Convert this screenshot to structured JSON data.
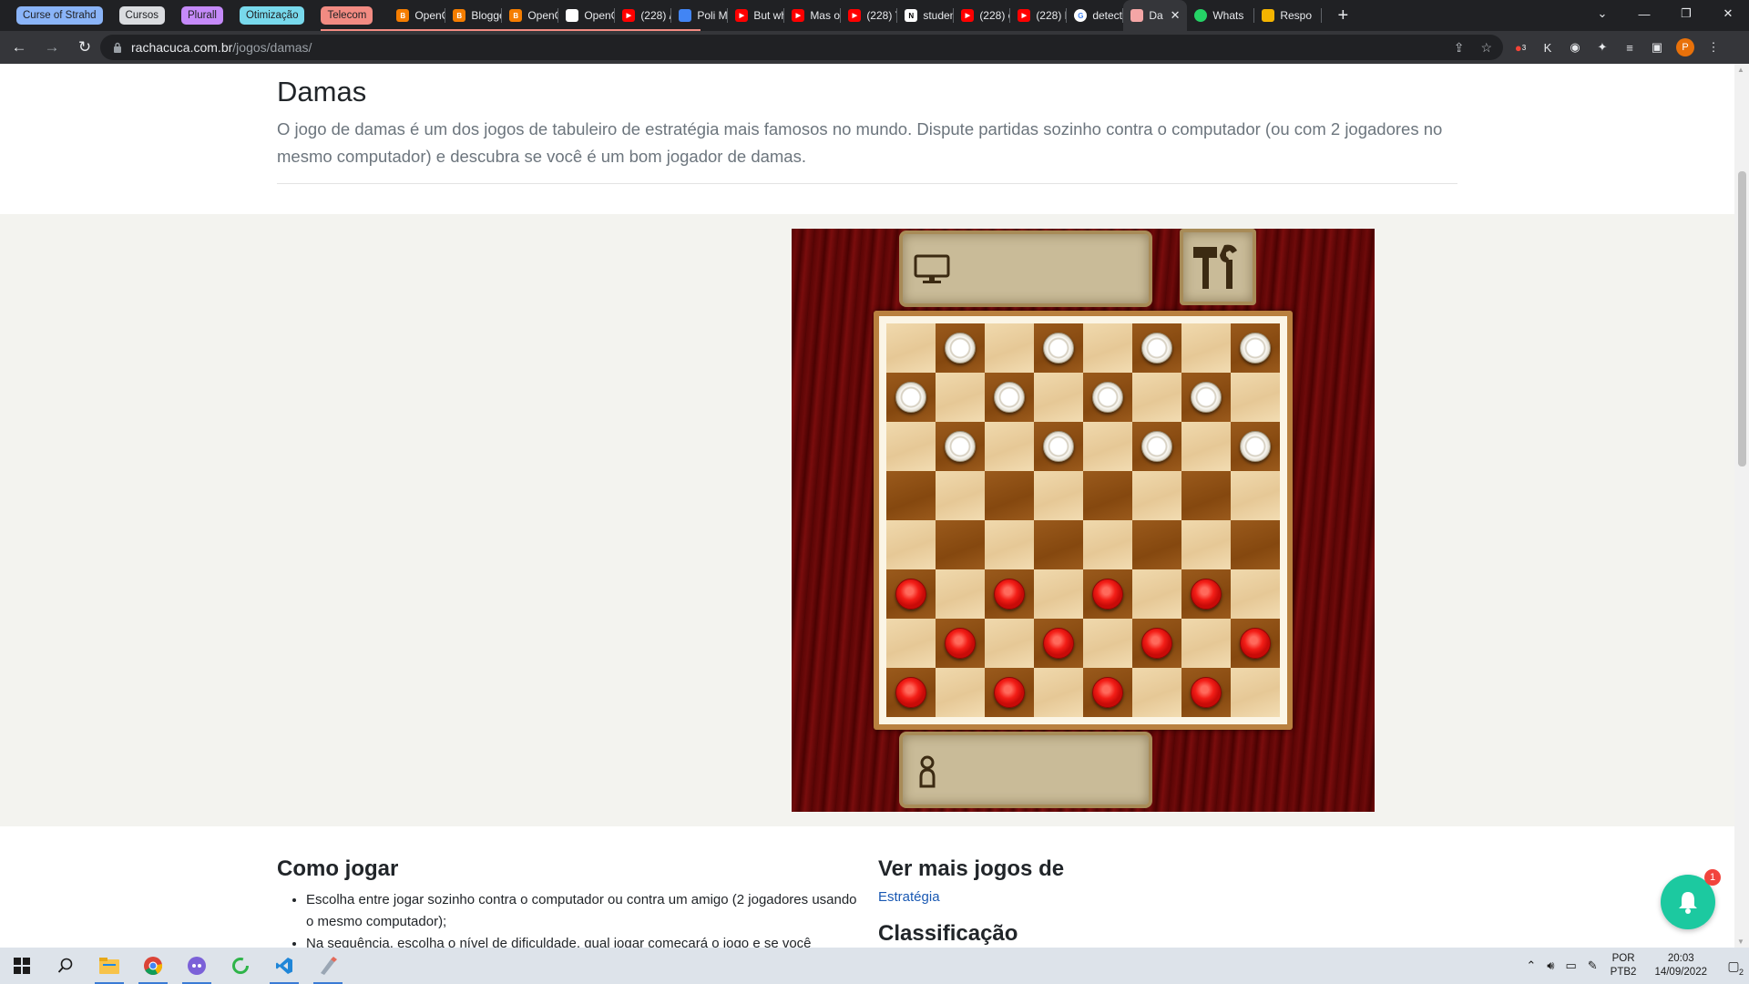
{
  "browser": {
    "tab_groups": [
      {
        "label": "Curse of Strahd",
        "color": "#8ab4f8"
      },
      {
        "label": "Cursos",
        "color": "#dadce0"
      },
      {
        "label": "Plurall",
        "color": "#c58af9"
      },
      {
        "label": "Otimização",
        "color": "#78d9ec"
      },
      {
        "label": "Telecom",
        "color": "#f28b82"
      }
    ],
    "tabs": [
      {
        "title": "OpenC",
        "icon": "blogger-icon",
        "color": "#f57d00"
      },
      {
        "title": "Blogge",
        "icon": "blogger-icon",
        "color": "#f57d00"
      },
      {
        "title": "OpenC",
        "icon": "blogger-icon",
        "color": "#f57d00"
      },
      {
        "title": "OpenC",
        "icon": "opencv-icon",
        "color": "#ffffff"
      },
      {
        "title": "(228) /",
        "icon": "youtube-icon",
        "color": "#ff0000"
      },
      {
        "title": "Poli M",
        "icon": "calendar-icon",
        "color": "#4285f4"
      },
      {
        "title": "But wh",
        "icon": "youtube-icon",
        "color": "#ff0000"
      },
      {
        "title": "Mas o",
        "icon": "youtube-icon",
        "color": "#ff0000"
      },
      {
        "title": "(228) Y",
        "icon": "youtube-icon",
        "color": "#ff0000"
      },
      {
        "title": "studen",
        "icon": "notion-icon",
        "color": "#ffffff"
      },
      {
        "title": "(228) c",
        "icon": "youtube-icon",
        "color": "#ff0000"
      },
      {
        "title": "(228) E",
        "icon": "youtube-icon",
        "color": "#ff0000"
      },
      {
        "title": "detect",
        "icon": "google-icon",
        "color": "#ffffff"
      },
      {
        "title": "Da",
        "icon": "racha-cuca-icon",
        "color": "#f4a6a6",
        "active": true
      },
      {
        "title": "Whats",
        "icon": "whatsapp-icon",
        "color": "#25d366"
      },
      {
        "title": "Respo",
        "icon": "chat-icon",
        "color": "#f4b400"
      }
    ],
    "url_host": "rachacuca.com.br",
    "url_path": "/jogos/damas/",
    "profile_initial": "P",
    "extension_badge": "3"
  },
  "page": {
    "title": "Damas",
    "description": "O jogo de damas é um dos jogos de tabuleiro de estratégia mais famosos no mundo. Dispute partidas sozinho contra o computador (ou com 2 jogadores no mesmo computador) e descubra se você é um bom jogador de damas."
  },
  "game": {
    "top_player": "computer-icon",
    "bottom_player": "pawn-icon",
    "board": [
      ". w . w . w . w",
      "w . w . w . w .",
      ". w . w . w . w",
      ". . . . . . . .",
      ". . . . . . . .",
      "r . r . r . r .",
      ". r . r . r . r",
      "r . r . r . r ."
    ]
  },
  "how_to_play": {
    "heading": "Como jogar",
    "items": [
      "Escolha entre jogar sozinho contra o computador ou contra um amigo (2 jogadores usando o mesmo computador);",
      "Na sequência, escolha o nível de dificuldade, qual jogar começará o jogo e se você"
    ]
  },
  "more_games": {
    "heading": "Ver mais jogos de",
    "link": "Estratégia",
    "classification": "Classificação"
  },
  "notifications": {
    "count": "1"
  },
  "taskbar": {
    "apps": [
      "windows-start-icon",
      "search-icon",
      "file-explorer-icon",
      "chrome-icon",
      "discord-icon",
      "refresh-app-icon",
      "vscode-icon",
      "paint-icon"
    ],
    "language": "POR",
    "layout": "PTB2",
    "time": "20:03",
    "date": "14/09/2022",
    "notif_count": "2"
  }
}
